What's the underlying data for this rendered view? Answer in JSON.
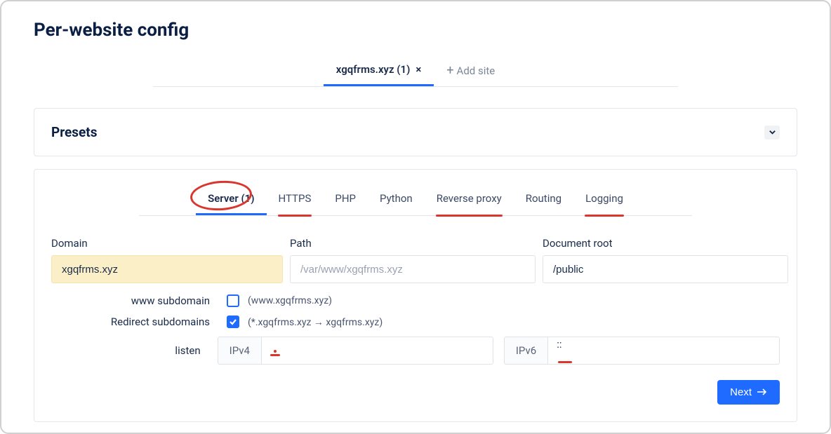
{
  "page_title": "Per-website config",
  "site_tabs": {
    "active": {
      "label": "xgqfrms.xyz (1)"
    },
    "add_label": "Add site"
  },
  "presets": {
    "title": "Presets"
  },
  "inner_tabs": [
    {
      "label": "Server (1)",
      "active": true,
      "circled": true
    },
    {
      "label": "HTTPS",
      "red_underline": true
    },
    {
      "label": "PHP"
    },
    {
      "label": "Python"
    },
    {
      "label": "Reverse proxy",
      "red_underline": true
    },
    {
      "label": "Routing"
    },
    {
      "label": "Logging",
      "red_underline": true
    }
  ],
  "form": {
    "domain_label": "Domain",
    "domain_value": "xgqfrms.xyz",
    "path_label": "Path",
    "path_placeholder": "/var/www/xgqfrms.xyz",
    "docroot_label": "Document root",
    "docroot_value": "/public",
    "www_sub_label": "www subdomain",
    "www_sub_desc": "(www.xgqfrms.xyz)",
    "www_sub_checked": false,
    "redirect_sub_label": "Redirect subdomains",
    "redirect_sub_desc": "(*.xgqfrms.xyz → xgqfrms.xyz)",
    "redirect_sub_checked": true,
    "listen_label": "listen",
    "ipv4_prefix": "IPv4",
    "ipv4_value": "",
    "ipv6_prefix": "IPv6",
    "ipv6_value": "::"
  },
  "next_label": "Next"
}
